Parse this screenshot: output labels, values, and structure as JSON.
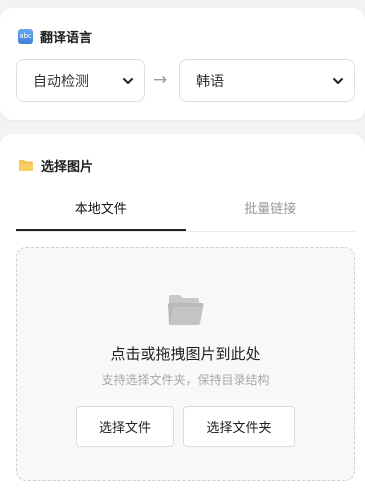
{
  "translate_section": {
    "title": "翻译语言",
    "icon": "abc-icon",
    "source_language": "自动检测",
    "arrow": "→",
    "target_language": "韩语"
  },
  "image_section": {
    "title": "选择图片",
    "icon": "folder-icon",
    "tabs": [
      {
        "label": "本地文件",
        "active": true
      },
      {
        "label": "批量链接",
        "active": false
      }
    ],
    "dropzone": {
      "icon": "open-folder-icon",
      "title": "点击或拖拽图片到此处",
      "subtitle": "支持选择文件夹，保持目录结构",
      "select_file_label": "选择文件",
      "select_folder_label": "选择文件夹"
    }
  },
  "colors": {
    "page_background": "#f3f3f4",
    "card_background": "#ffffff",
    "active_tab_underline": "#222222",
    "folder_yellow": "#f5c24c"
  }
}
